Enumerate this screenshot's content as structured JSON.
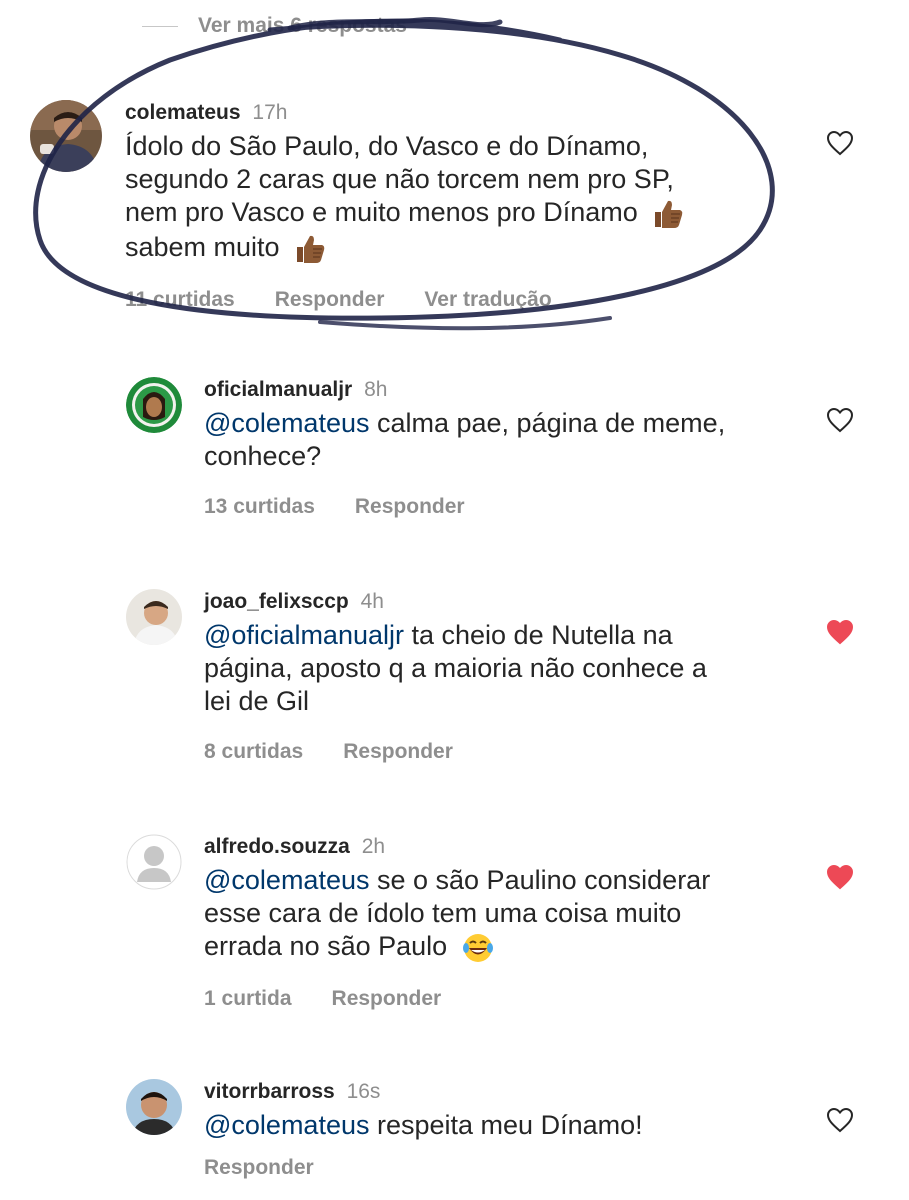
{
  "view_more": {
    "label": "Ver mais 6 respostas"
  },
  "comments": [
    {
      "username": "colemateus",
      "time": "17h",
      "lines": [
        "Ídolo do São Paulo, do Vasco e do Dínamo,",
        "segundo 2 caras que não torcem nem pro SP,",
        "nem pro Vasco e muito menos pro Dínamo",
        "sabem muito"
      ],
      "likes": "11 curtidas",
      "reply": "Responder",
      "translate": "Ver tradução",
      "liked": false
    },
    {
      "username": "oficialmanualjr",
      "time": "8h",
      "mention": "@colemateus",
      "lines": [
        " calma pae, página de meme,",
        "conhece?"
      ],
      "likes": "13 curtidas",
      "reply": "Responder",
      "liked": false
    },
    {
      "username": "joao_felixsccp",
      "time": "4h",
      "mention": "@oficialmanualjr",
      "lines": [
        " ta cheio de Nutella na",
        "página, aposto q a maioria não conhece a",
        "lei de Gil"
      ],
      "likes": "8 curtidas",
      "reply": "Responder",
      "liked": true
    },
    {
      "username": "alfredo.souzza",
      "time": "2h",
      "mention": "@colemateus",
      "lines": [
        " se o são Paulino considerar",
        "esse cara de ídolo tem uma coisa muito",
        "errada no são Paulo"
      ],
      "likes": "1 curtida",
      "reply": "Responder",
      "liked": true
    },
    {
      "username": "vitorrbarross",
      "time": "16s",
      "mention": "@colemateus",
      "lines": [
        " respeita meu Dínamo!"
      ],
      "reply": "Responder",
      "liked": false
    }
  ],
  "colors": {
    "text": "#262626",
    "secondary": "#8e8e8e",
    "mention": "#00376b",
    "heart_liked": "#ed4956",
    "scribble": "#1f2347"
  }
}
